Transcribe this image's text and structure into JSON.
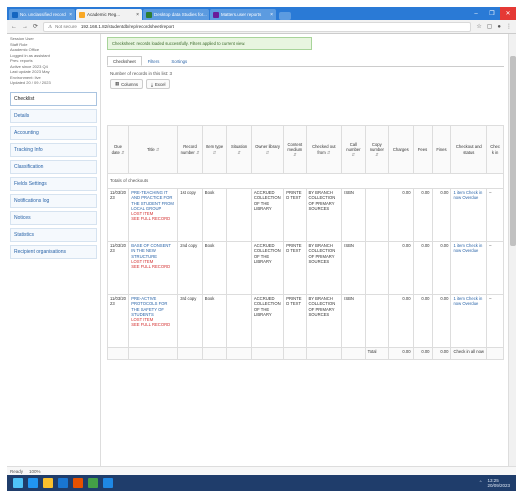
{
  "browser": {
    "tabs": [
      {
        "label": "No. unclassified record",
        "color": "#1565c0",
        "active": false
      },
      {
        "label": "Academic Reg...",
        "color": "#f9a825",
        "active": true
      },
      {
        "label": "Desktop data Studies for...",
        "color": "#2e7d32",
        "active": false
      },
      {
        "label": "Matters.user reports",
        "color": "#6a1b9a",
        "active": false
      }
    ],
    "address_prefix": "Not secure",
    "url": "192.168.1.82/studentdb/rep/recordsheet/report",
    "window_controls": [
      "–",
      "❐",
      "✕"
    ]
  },
  "sidebar": {
    "user_lines": [
      "Session User",
      "Staff Role",
      "Academic Office",
      "Logged in as assistant",
      "Prev. reports",
      "Active since 2023 Q4",
      "Last update 2023 May",
      "Environment: live",
      "Updated 20 / 09 / 2023"
    ],
    "items": [
      {
        "label": "Checklist",
        "active": true
      },
      {
        "label": "Details",
        "active": false
      },
      {
        "label": "Accounting",
        "active": false
      },
      {
        "label": "Tracking Info",
        "active": false
      },
      {
        "label": "Classification",
        "active": false
      },
      {
        "label": "Fields Settings",
        "active": false
      },
      {
        "label": "Notifications log",
        "active": false
      },
      {
        "label": "Notices",
        "active": false
      },
      {
        "label": "Statistics",
        "active": false
      },
      {
        "label": "Recipient organisations",
        "active": false
      }
    ]
  },
  "main": {
    "notice": "Checksheet: records loaded successfully. Filters applied to current view.",
    "tabs": [
      {
        "label": "Checksheet",
        "active": true
      },
      {
        "label": "Filters",
        "active": false
      },
      {
        "label": "Sortings",
        "active": false
      }
    ],
    "counts_text": "Number of records in this list: 3",
    "buttons": [
      {
        "icon": "columns-icon",
        "glyph": "▦",
        "label": "Columns"
      },
      {
        "icon": "excel-icon",
        "glyph": "⤓",
        "label": "Excel"
      }
    ],
    "table": {
      "columns": [
        "Due date",
        "Title",
        "Record number",
        "Item type",
        "Situation",
        "Owner library",
        "Content medium",
        "Checked out from",
        "Call number",
        "Copy number",
        "Charges",
        "Fees",
        "Fines",
        "Checkout and status",
        "Check in"
      ],
      "group_label": "Totals of checkouts",
      "rows": [
        {
          "due": "11/03/2023",
          "title": "PRE-TEACHING IT AND PRACTICE FOR THE STUDENT FROM LOCAL GROUP",
          "title_red": "LOST ITEM",
          "title_blue": "SEE FULL RECORD",
          "record": "1st copy",
          "type": "Book",
          "situation": "",
          "owner": "ACCRUED COLLECTION OF THE LIBRARY",
          "medium": "PRINTED TEXT",
          "checked": "BY BRANCH COLLECTION OF PRIMARY SOURCES",
          "call": "ISBN",
          "copy": "",
          "charges": "0.00",
          "fees": "0.00",
          "fines": "0.00",
          "status": "1 item Check in now Overdue",
          "checkin": "–"
        },
        {
          "due": "11/03/2023",
          "title": "BASE OF CONSENT IN THE NEW STRUCTURE",
          "title_red": "LOST ITEM",
          "title_blue": "SEE FULL RECORD",
          "record": "2nd copy",
          "type": "Book",
          "situation": "",
          "owner": "ACCRUED COLLECTION OF THE LIBRARY",
          "medium": "PRINTED TEXT",
          "checked": "BY BRANCH COLLECTION OF PRIMARY SOURCES",
          "call": "ISBN",
          "copy": "",
          "charges": "0.00",
          "fees": "0.00",
          "fines": "0.00",
          "status": "1 item Check in now Overdue",
          "checkin": "–"
        },
        {
          "due": "11/03/2023",
          "title": "PRE-ACTIVE PROTOCOLS FOR THE SAFETY OF STUDENTS",
          "title_red": "LOST ITEM",
          "title_blue": "SEE FULL RECORD",
          "record": "3rd copy",
          "type": "Book",
          "situation": "",
          "owner": "ACCRUED COLLECTION OF THE LIBRARY",
          "medium": "PRINTED TEXT",
          "checked": "BY BRANCH COLLECTION OF PRIMARY SOURCES",
          "call": "ISBN",
          "copy": "",
          "charges": "0.00",
          "fees": "0.00",
          "fines": "0.00",
          "status": "1 item Check in now Overdue",
          "checkin": "–"
        }
      ],
      "totals": {
        "label": "Total",
        "charges": "0.00",
        "fees": "0.00",
        "fines": "0.00",
        "status": "Check in all now"
      }
    }
  },
  "statusbar": {
    "left": "Ready",
    "right": "100%"
  },
  "taskbar": {
    "icons": [
      {
        "name": "windows-start-icon",
        "color": "#4fc3f7"
      },
      {
        "name": "edge-browser-icon",
        "color": "#2196f3"
      },
      {
        "name": "file-explorer-icon",
        "color": "#fbc02d"
      },
      {
        "name": "outlook-icon",
        "color": "#1976d2"
      },
      {
        "name": "powerpoint-icon",
        "color": "#e65100"
      },
      {
        "name": "chrome-icon",
        "color": "#43a047"
      },
      {
        "name": "word-icon",
        "color": "#1e88e5"
      }
    ],
    "time": "13:25",
    "date": "20/09/2023"
  }
}
